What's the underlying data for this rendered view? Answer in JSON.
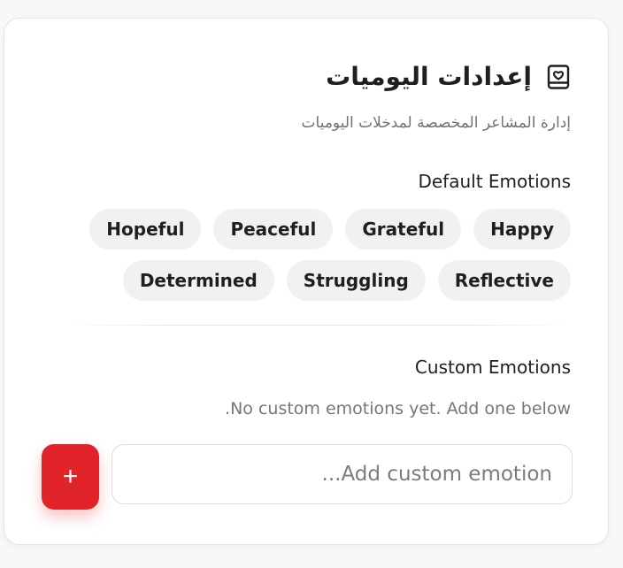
{
  "journal_settings": {
    "title": "إعدادات اليوميات",
    "subtitle": "إدارة المشاعر المخصصة لمدخلات اليوميات",
    "icon": "book-heart-icon"
  },
  "default_emotions": {
    "label": "Default Emotions",
    "items": [
      "Happy",
      "Grateful",
      "Peaceful",
      "Hopeful",
      "Reflective",
      "Struggling",
      "Determined"
    ]
  },
  "custom_emotions": {
    "label": "Custom Emotions",
    "empty_text": "No custom emotions yet. Add one below.",
    "input_placeholder": "Add custom emotion...",
    "input_value": "",
    "add_button_label": "+"
  },
  "colors": {
    "accent": "#e1242a",
    "chip_bg": "#f1f1ef",
    "text": "#1f1f1f",
    "muted": "#75716c"
  }
}
